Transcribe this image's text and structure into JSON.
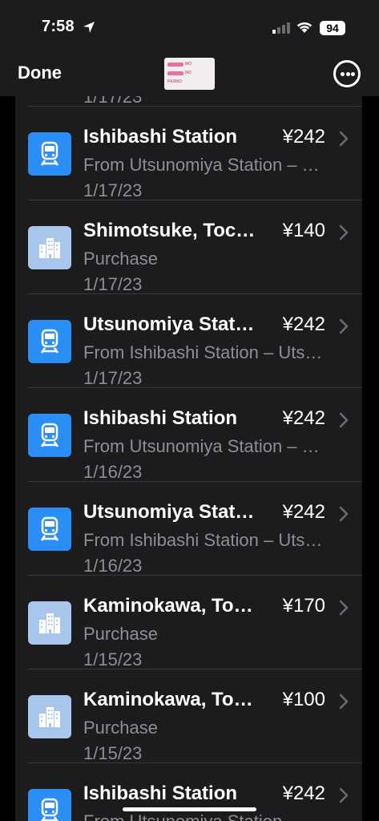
{
  "status_bar": {
    "time": "7:58",
    "battery": "94",
    "icons": [
      "location-arrow-icon",
      "cellular-signal-icon",
      "wifi-icon",
      "battery-icon"
    ]
  },
  "nav": {
    "done_label": "Done",
    "card_thumbnail": {
      "lines": [
        "MO",
        "MO",
        "PASMO"
      ],
      "accent_color": "#e76fa6"
    },
    "more_icon": "ellipsis-circle-icon"
  },
  "colors": {
    "background": "#1c1c1e",
    "train_icon_bg": "#2b8ef7",
    "purchase_icon_bg": "#a9c7ec",
    "secondary_text": "#8e8e93"
  },
  "transactions": [
    {
      "type": "train",
      "icon": "train-icon",
      "title": "Ishibashi Station",
      "amount": "¥242",
      "subtitle": "From Utsunomiya Station – Ishibashi",
      "date": "1/17/23"
    },
    {
      "type": "purchase",
      "icon": "building-icon",
      "title": "Shimotsuke, Tochigi",
      "amount": "¥140",
      "subtitle": "Purchase",
      "date": "1/17/23"
    },
    {
      "type": "train",
      "icon": "train-icon",
      "title": "Utsunomiya Station",
      "amount": "¥242",
      "subtitle": "From Ishibashi Station – Utsunomiya",
      "date": "1/17/23"
    },
    {
      "type": "train",
      "icon": "train-icon",
      "title": "Ishibashi Station",
      "amount": "¥242",
      "subtitle": "From Utsunomiya Station – Ishibashi",
      "date": "1/16/23"
    },
    {
      "type": "train",
      "icon": "train-icon",
      "title": "Utsunomiya Station",
      "amount": "¥242",
      "subtitle": "From Ishibashi Station – Utsunomiya",
      "date": "1/16/23"
    },
    {
      "type": "purchase",
      "icon": "building-icon",
      "title": "Kaminokawa, Tochigi",
      "amount": "¥170",
      "subtitle": "Purchase",
      "date": "1/15/23"
    },
    {
      "type": "purchase",
      "icon": "building-icon",
      "title": "Kaminokawa, Tochigi",
      "amount": "¥100",
      "subtitle": "Purchase",
      "date": "1/15/23"
    },
    {
      "type": "train",
      "icon": "train-icon",
      "title": "Ishibashi Station",
      "amount": "¥242",
      "subtitle": "From Utsunomiya Station – Ishibashi",
      "date": ""
    }
  ]
}
